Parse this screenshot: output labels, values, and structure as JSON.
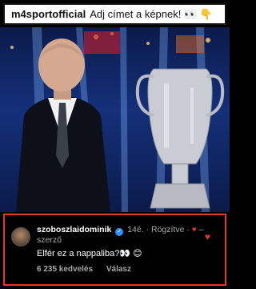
{
  "post": {
    "username": "m4sportofficial",
    "caption": "Adj címet a képnek! 👀 👇"
  },
  "comment": {
    "username": "szoboszlaidominik",
    "time": "14é.",
    "pinned_label": "Rögzítve",
    "author_label": "szerző",
    "text": "Elfér ez a nappaliba?👀 😊",
    "likes": "6 235 kedvelés",
    "reply_label": "Válasz"
  },
  "colors": {
    "highlight": "#e0372b",
    "verified": "#2e8fff"
  }
}
